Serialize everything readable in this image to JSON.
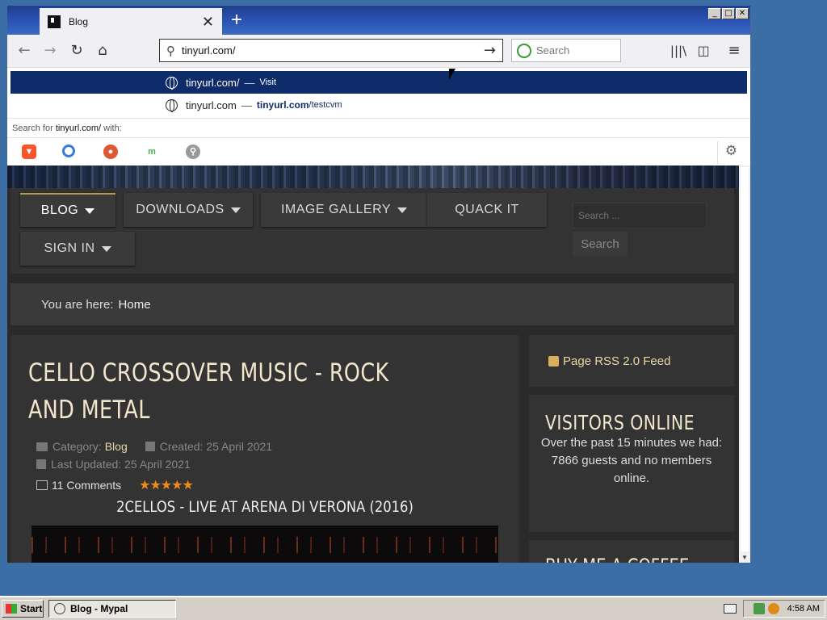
{
  "browser": {
    "tab_title": "Blog",
    "tab_close": "✕",
    "new_tab": "+",
    "window_buttons": [
      "_",
      "□",
      "✕"
    ],
    "url_value": "tinyurl.com/",
    "search_placeholder": "Search"
  },
  "dropdown": {
    "suggestion1": {
      "url": "tinyurl.com/",
      "sep": "—",
      "action": "Visit"
    },
    "suggestion2": {
      "url": "tinyurl.com",
      "sep": "—",
      "domain": "tinyurl.com",
      "path": "/testcvm"
    },
    "search_for_prefix": "Search for",
    "search_for_term": "tinyurl.com/",
    "search_for_suffix": "with:"
  },
  "site": {
    "menu": {
      "blog": "BLOG",
      "downloads": "DOWNLOADS",
      "gallery": "IMAGE GALLERY",
      "quack": "QUACK IT",
      "signin": "SIGN IN"
    },
    "search_placeholder": "Search ...",
    "search_button": "Search",
    "breadcrumb_label": "You are here:",
    "breadcrumb_home": "Home",
    "article": {
      "title": "CELLO CROSSOVER MUSIC - ROCK AND METAL",
      "category_label": "Category:",
      "category": "Blog",
      "created": "Created: 25 April 2021",
      "updated": "Last Updated: 25 April 2021",
      "comments": "11 Comments",
      "rating_stars": 5,
      "video_title": "2CELLOS - LIVE AT ARENA DI VERONA (2016)"
    },
    "sidebar": {
      "rss": "Page RSS 2.0 Feed",
      "visitors_title": "VISITORS ONLINE",
      "visitors_line1": "Over the past 15 minutes we had:",
      "visitors_line2": "7866 guests and no members online.",
      "coffee_title": "BUY ME A COFFEE"
    }
  },
  "taskbar": {
    "start": "Start",
    "task": "Blog - Mypal",
    "clock": "4:58 AM"
  },
  "colors": {
    "desktop": "#3a6ea5",
    "selected_suggestion": "#0f2c6a",
    "heading": "#f2e6cc",
    "star": "#f08a1c"
  }
}
